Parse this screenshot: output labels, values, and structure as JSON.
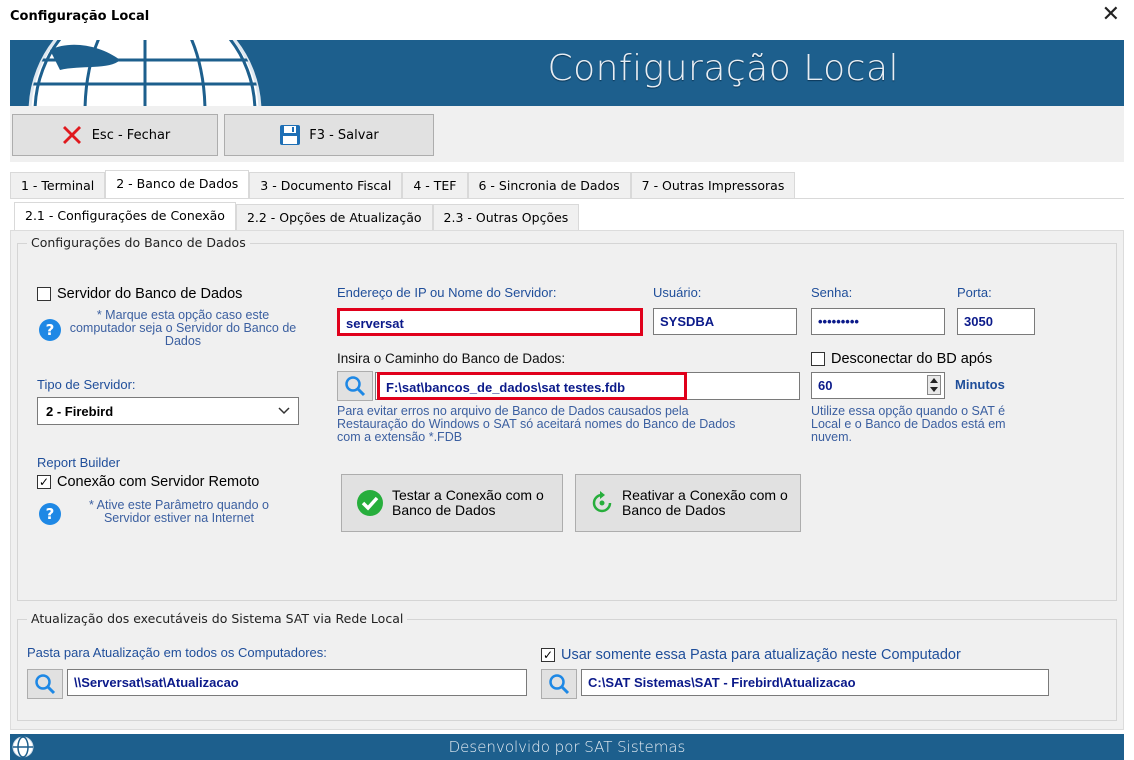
{
  "window": {
    "title": "Configuração Local",
    "close_glyph": "✕"
  },
  "banner": {
    "title": "Configuração Local"
  },
  "toolbar": {
    "close_label": "Esc - Fechar",
    "save_label": "F3 - Salvar"
  },
  "tabs": [
    "1 - Terminal",
    "2 - Banco de Dados",
    "3 - Documento Fiscal",
    "4 - TEF",
    "6 - Sincronia de Dados",
    "7 - Outras Impressoras"
  ],
  "subtabs": [
    "2.1 - Configurações de Conexão",
    "2.2 - Opções de Atualização",
    "2.3 - Outras Opções"
  ],
  "db_group": {
    "legend": "Configurações do Banco de Dados",
    "server_checkbox": "Servidor do Banco de Dados",
    "server_hint": "* Marque esta opção caso este computador seja o Servidor do Banco de Dados",
    "server_type_label": "Tipo de Servidor:",
    "server_type_value": "2 - Firebird",
    "report_builder_label": "Report Builder",
    "remote_checkbox": "Conexão com Servidor Remoto",
    "remote_hint": "* Ative este Parâmetro quando o Servidor estiver na Internet",
    "ip_label": "Endereço de IP ou Nome do Servidor:",
    "ip_value": "serversat",
    "user_label": "Usuário:",
    "user_value": "SYSDBA",
    "password_label": "Senha:",
    "password_value": "•••••••••",
    "port_label": "Porta:",
    "port_value": "3050",
    "path_label": "Insira o Caminho do Banco de Dados:",
    "path_value": "F:\\sat\\bancos_de_dados\\sat testes.fdb",
    "path_hint": "Para evitar erros no arquivo de Banco de Dados causados pela Restauração do Windows o SAT só aceitará nomes do Banco de Dados com a extensão *.FDB",
    "disconnect_checkbox": "Desconectar do BD após",
    "minutes_value": "60",
    "minutes_label": "Minutos",
    "disconnect_hint": "Utilize essa opção quando o SAT é Local e o Banco de Dados está em nuvem.",
    "test_button": "Testar a Conexão com o Banco de Dados",
    "reactivate_button": "Reativar a Conexão com o Banco de Dados"
  },
  "update_group": {
    "legend": "Atualização dos executáveis do Sistema SAT via Rede Local",
    "folder_label": "Pasta para Atualização em todos os Computadores:",
    "folder_value": "\\\\Serversat\\sat\\Atualizacao",
    "only_checkbox": "Usar somente essa Pasta para atualização neste Computador",
    "local_folder_value": "C:\\SAT Sistemas\\SAT - Firebird\\Atualizacao"
  },
  "footer": {
    "text": "Desenvolvido por SAT Sistemas"
  },
  "colors": {
    "banner": "#1d5f8d",
    "label_blue": "#1f4e9a",
    "highlight_red": "#e0001b"
  }
}
